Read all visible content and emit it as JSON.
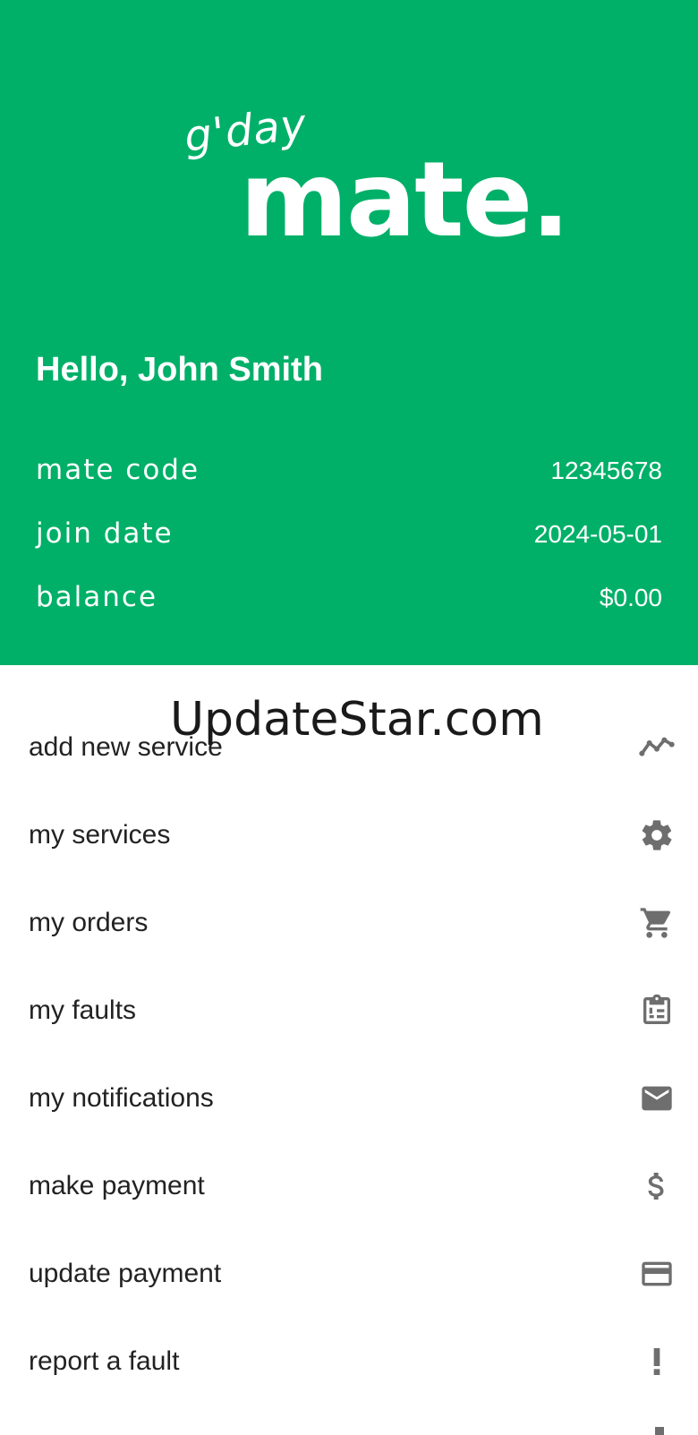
{
  "logo": {
    "small_text": "g'day",
    "big_text": "mate."
  },
  "greeting": "Hello, John Smith",
  "account": {
    "mate_code_label": "mate code",
    "mate_code_value": "12345678",
    "join_date_label": "join date",
    "join_date_value": "2024-05-01",
    "balance_label": "balance",
    "balance_value": "$0.00"
  },
  "watermark": "UpdateStar.com",
  "menu": {
    "items": [
      {
        "label": "add new service",
        "icon": "trending-icon"
      },
      {
        "label": "my services",
        "icon": "gear-icon"
      },
      {
        "label": "my orders",
        "icon": "cart-icon"
      },
      {
        "label": "my faults",
        "icon": "clipboard-icon"
      },
      {
        "label": "my notifications",
        "icon": "mail-icon"
      },
      {
        "label": "make payment",
        "icon": "dollar-icon"
      },
      {
        "label": "update payment",
        "icon": "credit-card-icon"
      },
      {
        "label": "report a fault",
        "icon": "exclamation-icon"
      }
    ]
  },
  "colors": {
    "brand_green": "#00b068",
    "icon_gray": "#6e6e6e",
    "text_dark": "#222222"
  }
}
